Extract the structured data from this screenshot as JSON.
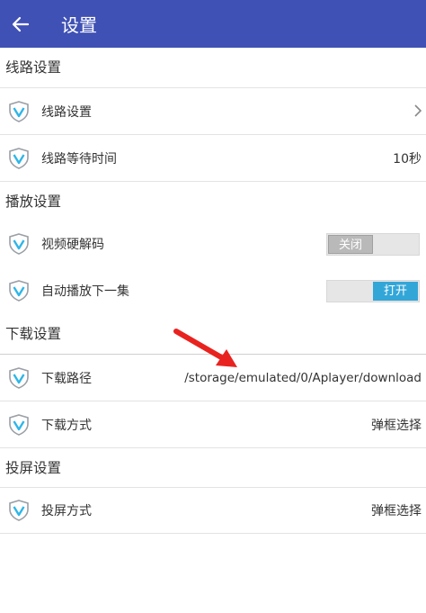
{
  "header": {
    "title": "设置"
  },
  "sections": [
    {
      "title": "线路设置",
      "rows": [
        {
          "label": "线路设置",
          "value": ""
        },
        {
          "label": "线路等待时间",
          "value": "10秒"
        }
      ]
    },
    {
      "title": "播放设置",
      "rows": [
        {
          "label": "视频硬解码",
          "toggle_label": "关闭",
          "toggle_state": "off"
        },
        {
          "label": "自动播放下一集",
          "toggle_label": "打开",
          "toggle_state": "on"
        }
      ]
    },
    {
      "title": "下载设置",
      "rows": [
        {
          "label": "下载路径",
          "value": "/storage/emulated/0/Aplayer/download"
        },
        {
          "label": "下载方式",
          "value": "弹框选择"
        }
      ]
    },
    {
      "title": "投屏设置",
      "rows": [
        {
          "label": "投屏方式",
          "value": "弹框选择"
        }
      ]
    }
  ],
  "colors": {
    "app_bar": "#3f51b5",
    "toggle_on": "#33a6d8",
    "arrow": "#e8231f",
    "shield": "#9aa0a6",
    "shield_mark": "#2fb6e8"
  }
}
